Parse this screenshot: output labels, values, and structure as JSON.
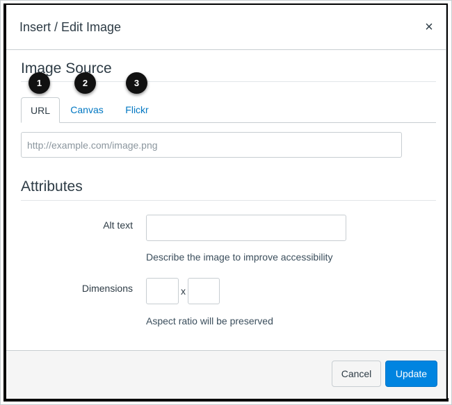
{
  "dialog": {
    "title": "Insert / Edit Image",
    "close_symbol": "×"
  },
  "image_source": {
    "heading": "Image Source",
    "tabs": [
      {
        "label": "URL",
        "active": true
      },
      {
        "label": "Canvas",
        "active": false
      },
      {
        "label": "Flickr",
        "active": false
      }
    ],
    "url_placeholder": "http://example.com/image.png",
    "url_value": ""
  },
  "callouts": [
    "1",
    "2",
    "3"
  ],
  "attributes": {
    "heading": "Attributes",
    "alt_text": {
      "label": "Alt text",
      "value": "",
      "help": "Describe the image to improve accessibility"
    },
    "dimensions": {
      "label": "Dimensions",
      "width": "",
      "height": "",
      "separator": "x",
      "help": "Aspect ratio will be preserved"
    }
  },
  "footer": {
    "cancel_label": "Cancel",
    "update_label": "Update"
  },
  "colors": {
    "link": "#0077c2",
    "primary_button": "#0084e0",
    "callout_badge": "#111111"
  }
}
